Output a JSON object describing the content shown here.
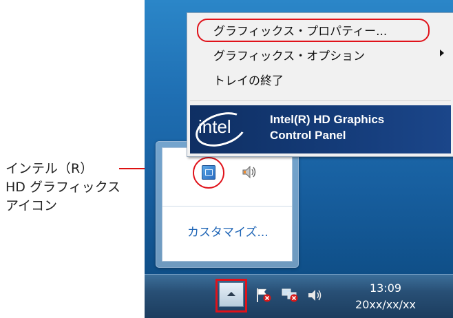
{
  "callout": {
    "line1": "インテル（R）",
    "line2": "HD グラフィックス",
    "line3": "アイコン"
  },
  "context_menu": {
    "items": [
      {
        "label": "グラフィックス・プロパティー..."
      },
      {
        "label": "グラフィックス・オプション"
      },
      {
        "label": "トレイの終了"
      }
    ],
    "banner": {
      "logo_text": "intel",
      "product_line1": "Intel(R) HD Graphics",
      "product_line2": "Control Panel"
    }
  },
  "tray_popup": {
    "customize_label": "カスタマイズ..."
  },
  "taskbar": {
    "time": "13:09",
    "date": "20xx/xx/xx"
  },
  "colors": {
    "highlight_red": "#e0121a",
    "link_blue": "#1c63b5",
    "intel_banner": "#143b78"
  },
  "icons": [
    "intel-graphics-tray-icon",
    "speaker-icon",
    "action-center-flag-icon",
    "network-icon",
    "volume-icon",
    "chevron-up-icon",
    "submenu-arrow-icon"
  ]
}
